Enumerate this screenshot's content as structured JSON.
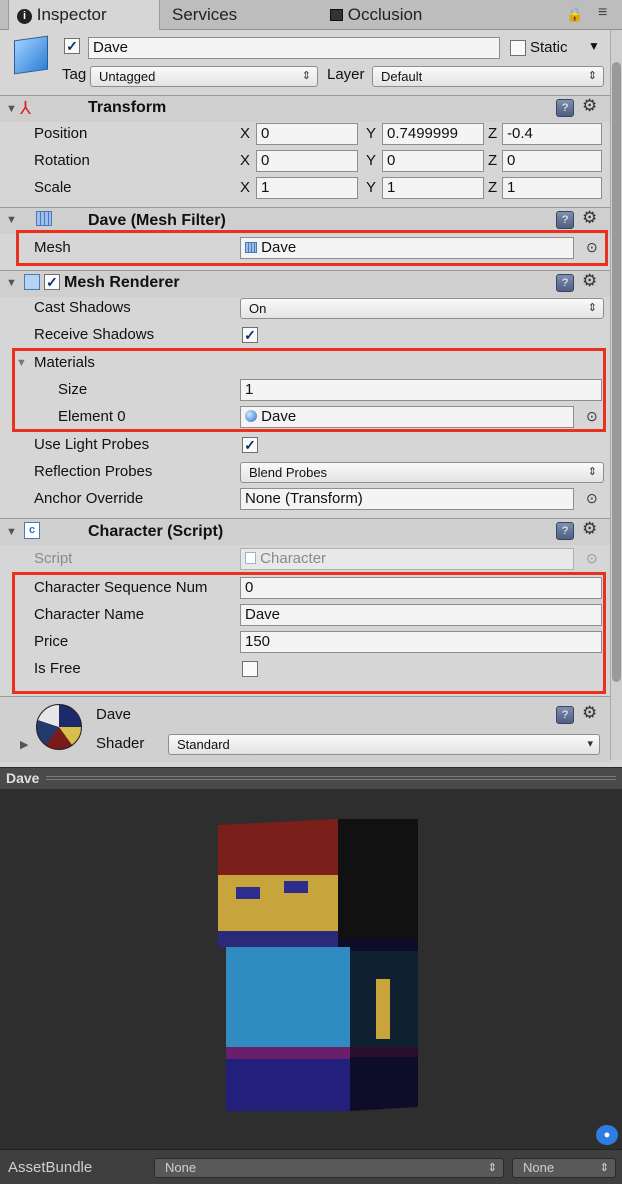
{
  "tabs": [
    {
      "label": "Inspector"
    },
    {
      "label": "Services"
    },
    {
      "label": "Occlusion"
    }
  ],
  "object": {
    "name": "Dave",
    "active": true,
    "static_label": "Static",
    "static": false,
    "tag_label": "Tag",
    "tag_value": "Untagged",
    "layer_label": "Layer",
    "layer_value": "Default"
  },
  "transform": {
    "title": "Transform",
    "position": {
      "label": "Position",
      "x": "0",
      "y": "0.7499999",
      "z": "-0.4"
    },
    "rotation": {
      "label": "Rotation",
      "x": "0",
      "y": "0",
      "z": "0"
    },
    "scale": {
      "label": "Scale",
      "x": "1",
      "y": "1",
      "z": "1"
    },
    "axis_x": "X",
    "axis_y": "Y",
    "axis_z": "Z"
  },
  "mesh_filter": {
    "title": "Dave (Mesh Filter)",
    "mesh_label": "Mesh",
    "mesh_value": "Dave"
  },
  "mesh_renderer": {
    "title": "Mesh Renderer",
    "enabled": true,
    "cast_shadows_label": "Cast Shadows",
    "cast_shadows_value": "On",
    "receive_shadows_label": "Receive Shadows",
    "receive_shadows": true,
    "materials_label": "Materials",
    "size_label": "Size",
    "size_value": "1",
    "element0_label": "Element 0",
    "element0_value": "Dave",
    "light_probes_label": "Use Light Probes",
    "light_probes": true,
    "reflection_probes_label": "Reflection Probes",
    "reflection_probes_value": "Blend Probes",
    "anchor_override_label": "Anchor Override",
    "anchor_override_value": "None (Transform)"
  },
  "character_script": {
    "title": "Character (Script)",
    "script_label": "Script",
    "script_value": "Character",
    "seq_label": "Character Sequence Num",
    "seq_value": "0",
    "name_label": "Character Name",
    "name_value": "Dave",
    "price_label": "Price",
    "price_value": "150",
    "is_free_label": "Is Free",
    "is_free": false
  },
  "material": {
    "name": "Dave",
    "shader_label": "Shader",
    "shader_value": "Standard"
  },
  "preview": {
    "title": "Dave"
  },
  "asset_bundle": {
    "label": "AssetBundle",
    "value1": "None",
    "value2": "None"
  },
  "colors": {
    "highlight": "#e8321e",
    "panel_bg": "#d6d6d6",
    "preview_bg": "#2e2e2e"
  }
}
